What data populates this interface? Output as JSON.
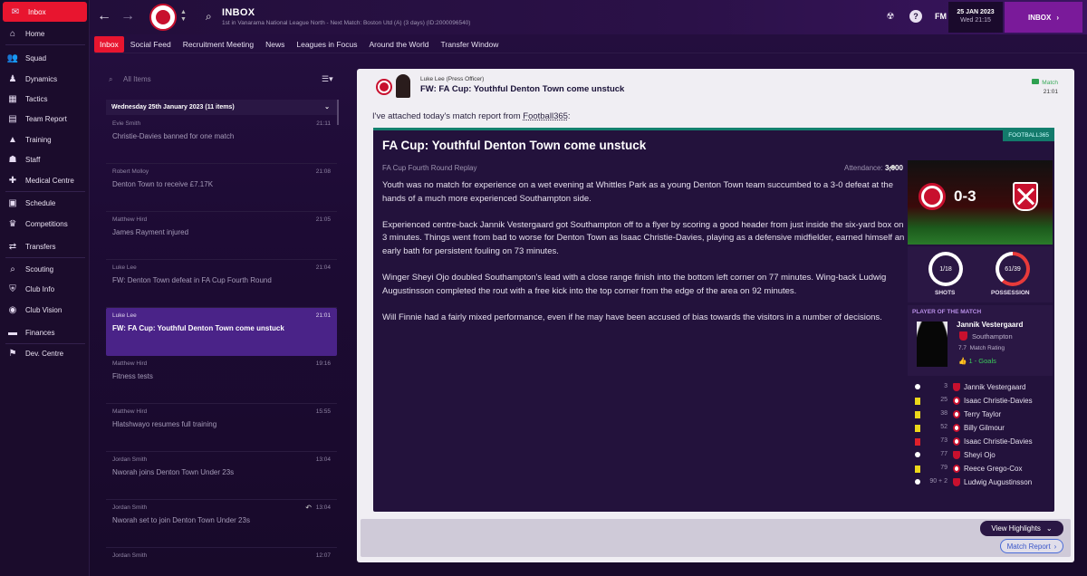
{
  "sidebar": {
    "items": [
      {
        "label": "Inbox",
        "icon": "inbox-icon",
        "glyph": "✉"
      },
      {
        "label": "Home",
        "icon": "home-icon",
        "glyph": "⌂"
      },
      {
        "label": "Squad",
        "icon": "squad-icon",
        "glyph": "👥"
      },
      {
        "label": "Dynamics",
        "icon": "dynamics-icon",
        "glyph": "♟"
      },
      {
        "label": "Tactics",
        "icon": "tactics-icon",
        "glyph": "▦"
      },
      {
        "label": "Team Report",
        "icon": "team-report-icon",
        "glyph": "▤"
      },
      {
        "label": "Training",
        "icon": "training-icon",
        "glyph": "▲"
      },
      {
        "label": "Staff",
        "icon": "staff-icon",
        "glyph": "☗"
      },
      {
        "label": "Medical Centre",
        "icon": "medical-icon",
        "glyph": "✚"
      },
      {
        "label": "Schedule",
        "icon": "schedule-icon",
        "glyph": "▣"
      },
      {
        "label": "Competitions",
        "icon": "competitions-icon",
        "glyph": "♛"
      },
      {
        "label": "Transfers",
        "icon": "transfers-icon",
        "glyph": "⇄"
      },
      {
        "label": "Scouting",
        "icon": "scouting-icon",
        "glyph": "⌕"
      },
      {
        "label": "Club Info",
        "icon": "club-info-icon",
        "glyph": "⛨"
      },
      {
        "label": "Club Vision",
        "icon": "club-vision-icon",
        "glyph": "◉"
      },
      {
        "label": "Finances",
        "icon": "finances-icon",
        "glyph": "▬"
      },
      {
        "label": "Dev. Centre",
        "icon": "dev-centre-icon",
        "glyph": "⚑"
      }
    ]
  },
  "header": {
    "title": "INBOX",
    "subtitle": "1st in Vanarama National League North - Next Match: Boston Utd (A) (3 days) (ID:2000096540)",
    "date": "25 JAN 2023",
    "day_time": "Wed 21:15",
    "fm_logo": "FM",
    "inbox_button": "INBOX",
    "back_arrow": "←",
    "forward_arrow": "→"
  },
  "tabs": [
    "Inbox",
    "Social Feed",
    "Recruitment Meeting",
    "News",
    "Leagues in Focus",
    "Around the World",
    "Transfer Window"
  ],
  "list": {
    "search_placeholder": "All Items",
    "group_header": "Wednesday 25th January 2023 (11 items)",
    "messages": [
      {
        "sender": "Evie Smith",
        "time": "21:11",
        "subject": "Christie-Davies banned for one match"
      },
      {
        "sender": "Robert Molloy",
        "time": "21:08",
        "subject": "Denton Town to receive £7.17K"
      },
      {
        "sender": "Matthew Hird",
        "time": "21:05",
        "subject": "James Rayment injured"
      },
      {
        "sender": "Luke Lee",
        "time": "21:04",
        "subject": "FW: Denton Town defeat in FA Cup Fourth Round"
      },
      {
        "sender": "Luke Lee",
        "time": "21:01",
        "subject": "FW: FA Cup: Youthful Denton Town come unstuck"
      },
      {
        "sender": "Matthew Hird",
        "time": "19:16",
        "subject": "Fitness tests"
      },
      {
        "sender": "Matthew Hird",
        "time": "15:55",
        "subject": "Hlatshwayo resumes full training"
      },
      {
        "sender": "Jordan Smith",
        "time": "13:04",
        "subject": "Nworah joins Denton Town Under 23s"
      },
      {
        "sender": "Jordan Smith",
        "time": "13:04",
        "subject": "Nworah set to join Denton Town Under 23s"
      },
      {
        "sender": "Jordan Smith",
        "time": "12:07",
        "subject": ""
      }
    ]
  },
  "detail": {
    "sender": "Luke Lee",
    "sender_role": "(Press Officer)",
    "subject": "FW: FA Cup: Youthful Denton Town come unstuck",
    "tag": "Match",
    "time": "21:01",
    "intro": "I've attached today's match report from ",
    "intro_source": "Football365",
    "intro_end": ":"
  },
  "report": {
    "brand": "FOOTBALL365",
    "title": "FA Cup: Youthful Denton Town come unstuck",
    "competition": "FA Cup Fourth Round Replay",
    "attendance_label": "Attendance:",
    "attendance": "3,000",
    "paragraphs": [
      "Youth was no match for experience on a wet evening at Whittles Park as a young Denton Town team succumbed to a 3-0 defeat at the hands of a much more experienced Southampton side.",
      "Experienced centre-back Jannik Vestergaard got Southampton off to a flyer by scoring a good header from just inside the six-yard box on 3 minutes. Things went from bad to worse for Denton Town as Isaac Christie-Davies, playing as a defensive midfielder, earned himself an early bath for persistent fouling on 73 minutes.",
      "Winger Sheyi Ojo doubled Southampton's lead with a close range finish into the bottom left corner on 77 minutes. Wing-back Ludwig Augustinsson completed the rout with a free kick into the top corner from the edge of the area on 92 minutes.",
      "Will Finnie had a fairly mixed performance, even if he may have been accused of bias towards the visitors in a number of decisions."
    ],
    "score": "0-3",
    "shots": "1/18",
    "shots_label": "SHOTS",
    "shots_home_fraction": 0.05,
    "possession": "61/39",
    "possession_label": "POSSESSION",
    "possession_home_fraction": 0.61,
    "potm_label": "PLAYER OF THE MATCH",
    "potm_name": "Jannik Vestergaard",
    "potm_club": "Southampton",
    "potm_rating": "7.7",
    "potm_rating_label": "Match Rating",
    "potm_goals": "1 - Goals",
    "colors": {
      "home": "#c8102e",
      "away": "#c8102e",
      "accent": "#7a1a9a",
      "teal": "#137a6b"
    },
    "events": [
      {
        "type": "goal",
        "minute": "3",
        "team": "away",
        "player": "Jannik Vestergaard"
      },
      {
        "type": "yellow",
        "minute": "25",
        "team": "home",
        "player": "Isaac Christie-Davies"
      },
      {
        "type": "yellow",
        "minute": "38",
        "team": "home",
        "player": "Terry Taylor"
      },
      {
        "type": "yellow",
        "minute": "52",
        "team": "home",
        "player": "Billy Gilmour"
      },
      {
        "type": "red",
        "minute": "73",
        "team": "home",
        "player": "Isaac Christie-Davies"
      },
      {
        "type": "goal",
        "minute": "77",
        "team": "away",
        "player": "Sheyi Ojo"
      },
      {
        "type": "yellow",
        "minute": "79",
        "team": "home",
        "player": "Reece Grego-Cox"
      },
      {
        "type": "goal",
        "minute": "90 + 2",
        "team": "away",
        "player": "Ludwig Augustinsson"
      }
    ],
    "view_highlights": "View Highlights",
    "match_report": "Match Report"
  }
}
